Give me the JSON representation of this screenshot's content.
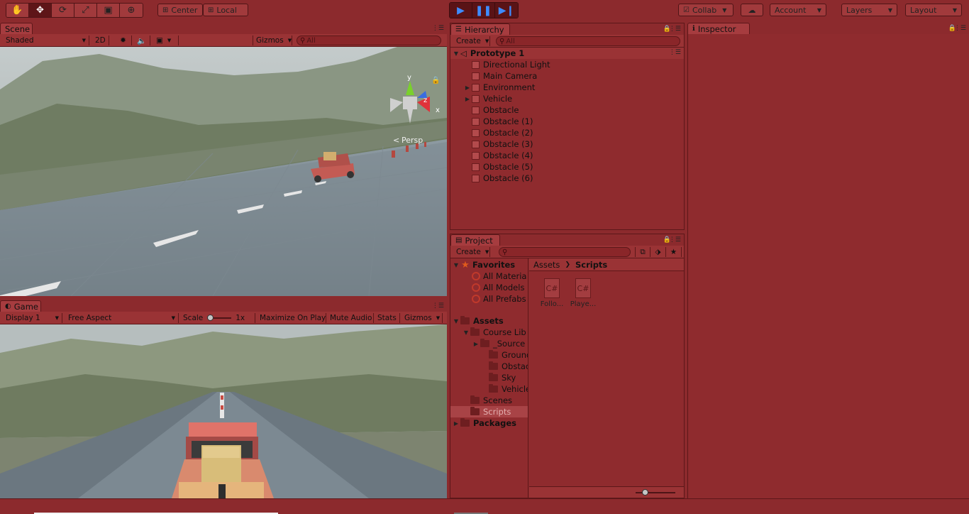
{
  "toolbar": {
    "tools": [
      {
        "icon": "hand-icon"
      },
      {
        "icon": "move-icon"
      },
      {
        "icon": "rotate-icon"
      },
      {
        "icon": "scale-icon"
      },
      {
        "icon": "rect-icon"
      },
      {
        "icon": "transform-icon"
      }
    ],
    "pivot_label": "Center",
    "space_label": "Local",
    "collab_label": "Collab",
    "account_label": "Account",
    "layers_label": "Layers",
    "layout_label": "Layout"
  },
  "scene": {
    "tab_label": "Scene",
    "shading_mode": "Shaded",
    "mode_2d": "2D",
    "gizmos_label": "Gizmos",
    "search_placeholder": "All",
    "persp_label": "Persp",
    "axis_y": "y",
    "axis_x": "x",
    "axis_z": "z"
  },
  "game": {
    "tab_label": "Game",
    "display_label": "Display 1",
    "aspect_label": "Free Aspect",
    "scale_label": "Scale",
    "scale_value": "1x",
    "maximize_label": "Maximize On Play",
    "mute_label": "Mute Audio",
    "stats_label": "Stats",
    "gizmos_label": "Gizmos"
  },
  "hierarchy": {
    "tab_label": "Hierarchy",
    "create_label": "Create",
    "search_placeholder": "All",
    "scene_name": "Prototype 1",
    "items": [
      {
        "label": "Directional Light",
        "expandable": false
      },
      {
        "label": "Main Camera",
        "expandable": false
      },
      {
        "label": "Environment",
        "expandable": true
      },
      {
        "label": "Vehicle",
        "expandable": true
      },
      {
        "label": "Obstacle",
        "expandable": false
      },
      {
        "label": "Obstacle (1)",
        "expandable": false
      },
      {
        "label": "Obstacle (2)",
        "expandable": false
      },
      {
        "label": "Obstacle (3)",
        "expandable": false
      },
      {
        "label": "Obstacle (4)",
        "expandable": false
      },
      {
        "label": "Obstacle (5)",
        "expandable": false
      },
      {
        "label": "Obstacle (6)",
        "expandable": false
      }
    ]
  },
  "project": {
    "tab_label": "Project",
    "create_label": "Create",
    "favorites_label": "Favorites",
    "favorites": [
      "All Materia",
      "All Models",
      "All Prefabs"
    ],
    "assets_label": "Assets",
    "tree": [
      {
        "label": "Course Lib"
      },
      {
        "label": "_Source"
      },
      {
        "label": "Ground"
      },
      {
        "label": "Obstacle"
      },
      {
        "label": "Sky"
      },
      {
        "label": "Vehicles"
      },
      {
        "label": "Scenes"
      },
      {
        "label": "Scripts"
      }
    ],
    "packages_label": "Packages",
    "breadcrumb": [
      "Assets",
      "Scripts"
    ],
    "files": [
      {
        "name": "Follo...",
        "type": "C#"
      },
      {
        "name": "Playe...",
        "type": "C#"
      }
    ]
  },
  "inspector": {
    "tab_label": "Inspector"
  }
}
